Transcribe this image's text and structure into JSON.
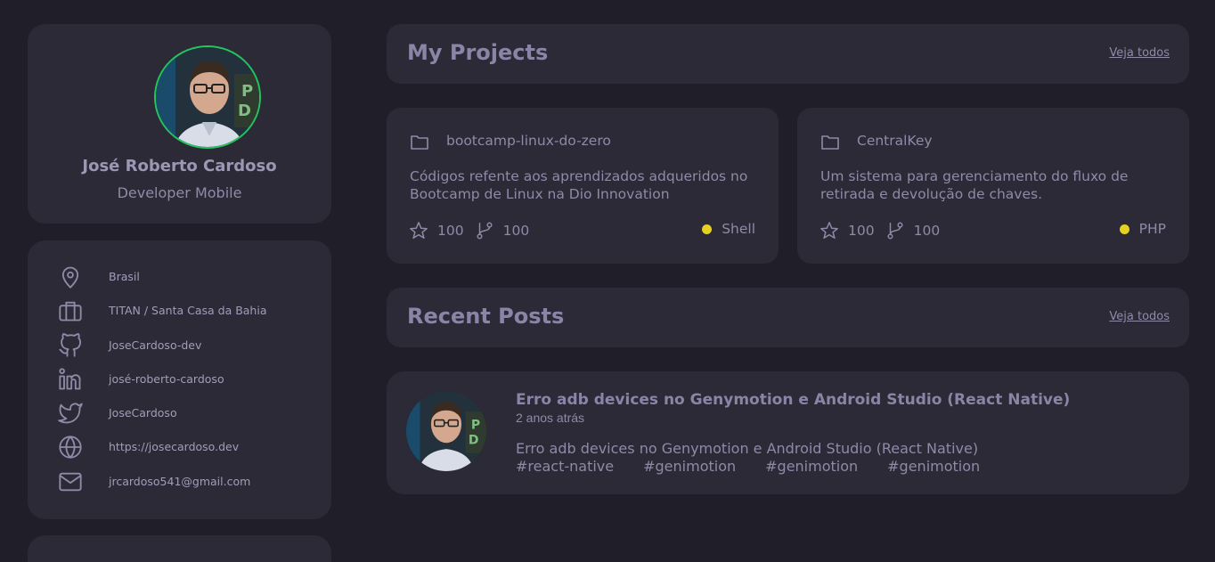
{
  "profile": {
    "name": "José Roberto Cardoso",
    "role": "Developer Mobile"
  },
  "contacts": [
    {
      "icon": "location-pin-icon",
      "text": "Brasil"
    },
    {
      "icon": "briefcase-icon",
      "text": "TITAN / Santa Casa da Bahia"
    },
    {
      "icon": "github-icon",
      "text": "JoseCardoso-dev"
    },
    {
      "icon": "linkedin-icon",
      "text": "josé-roberto-cardoso"
    },
    {
      "icon": "twitter-icon",
      "text": "JoseCardoso"
    },
    {
      "icon": "globe-icon",
      "text": "https://josecardoso.dev"
    },
    {
      "icon": "mail-icon",
      "text": "jrcardoso541@gmail.com"
    }
  ],
  "projects_section": {
    "title": "My Projects",
    "see_all": "Veja todos"
  },
  "projects": [
    {
      "name": "bootcamp-linux-do-zero",
      "description": "Códigos refente aos aprendizados adqueridos no Bootcamp de Linux na Dio Innovation",
      "stars": "100",
      "forks": "100",
      "language": "Shell",
      "language_color": "#e5d11f"
    },
    {
      "name": "CentralKey",
      "description": "Um sistema para gerenciamento do fluxo de retirada e devolução de chaves.",
      "stars": "100",
      "forks": "100",
      "language": "PHP",
      "language_color": "#e5d11f"
    }
  ],
  "posts_section": {
    "title": "Recent Posts",
    "see_all": "Veja todos"
  },
  "post": {
    "title": "Erro adb devices no Genymotion e Android Studio (React Native)",
    "time": "2 anos atrás",
    "description": "Erro adb devices no Genymotion e Android Studio (React Native)",
    "tags": [
      "#react-native",
      "#genimotion",
      "#genimotion",
      "#genimotion"
    ]
  },
  "colors": {
    "background": "#201f29",
    "card": "#2b2a36",
    "avatar_border": "#22c55e",
    "text": "#8f8aa8"
  }
}
